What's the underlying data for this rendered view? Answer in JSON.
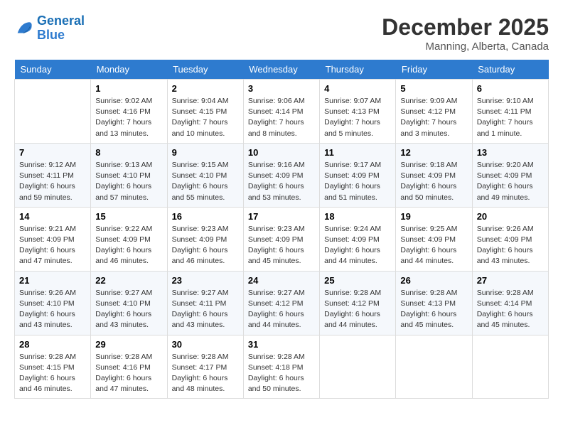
{
  "header": {
    "logo_line1": "General",
    "logo_line2": "Blue",
    "month": "December 2025",
    "location": "Manning, Alberta, Canada"
  },
  "days_of_week": [
    "Sunday",
    "Monday",
    "Tuesday",
    "Wednesday",
    "Thursday",
    "Friday",
    "Saturday"
  ],
  "weeks": [
    [
      {
        "day": "",
        "info": ""
      },
      {
        "day": "1",
        "info": "Sunrise: 9:02 AM\nSunset: 4:16 PM\nDaylight: 7 hours\nand 13 minutes."
      },
      {
        "day": "2",
        "info": "Sunrise: 9:04 AM\nSunset: 4:15 PM\nDaylight: 7 hours\nand 10 minutes."
      },
      {
        "day": "3",
        "info": "Sunrise: 9:06 AM\nSunset: 4:14 PM\nDaylight: 7 hours\nand 8 minutes."
      },
      {
        "day": "4",
        "info": "Sunrise: 9:07 AM\nSunset: 4:13 PM\nDaylight: 7 hours\nand 5 minutes."
      },
      {
        "day": "5",
        "info": "Sunrise: 9:09 AM\nSunset: 4:12 PM\nDaylight: 7 hours\nand 3 minutes."
      },
      {
        "day": "6",
        "info": "Sunrise: 9:10 AM\nSunset: 4:11 PM\nDaylight: 7 hours\nand 1 minute."
      }
    ],
    [
      {
        "day": "7",
        "info": "Sunrise: 9:12 AM\nSunset: 4:11 PM\nDaylight: 6 hours\nand 59 minutes."
      },
      {
        "day": "8",
        "info": "Sunrise: 9:13 AM\nSunset: 4:10 PM\nDaylight: 6 hours\nand 57 minutes."
      },
      {
        "day": "9",
        "info": "Sunrise: 9:15 AM\nSunset: 4:10 PM\nDaylight: 6 hours\nand 55 minutes."
      },
      {
        "day": "10",
        "info": "Sunrise: 9:16 AM\nSunset: 4:09 PM\nDaylight: 6 hours\nand 53 minutes."
      },
      {
        "day": "11",
        "info": "Sunrise: 9:17 AM\nSunset: 4:09 PM\nDaylight: 6 hours\nand 51 minutes."
      },
      {
        "day": "12",
        "info": "Sunrise: 9:18 AM\nSunset: 4:09 PM\nDaylight: 6 hours\nand 50 minutes."
      },
      {
        "day": "13",
        "info": "Sunrise: 9:20 AM\nSunset: 4:09 PM\nDaylight: 6 hours\nand 49 minutes."
      }
    ],
    [
      {
        "day": "14",
        "info": "Sunrise: 9:21 AM\nSunset: 4:09 PM\nDaylight: 6 hours\nand 47 minutes."
      },
      {
        "day": "15",
        "info": "Sunrise: 9:22 AM\nSunset: 4:09 PM\nDaylight: 6 hours\nand 46 minutes."
      },
      {
        "day": "16",
        "info": "Sunrise: 9:23 AM\nSunset: 4:09 PM\nDaylight: 6 hours\nand 46 minutes."
      },
      {
        "day": "17",
        "info": "Sunrise: 9:23 AM\nSunset: 4:09 PM\nDaylight: 6 hours\nand 45 minutes."
      },
      {
        "day": "18",
        "info": "Sunrise: 9:24 AM\nSunset: 4:09 PM\nDaylight: 6 hours\nand 44 minutes."
      },
      {
        "day": "19",
        "info": "Sunrise: 9:25 AM\nSunset: 4:09 PM\nDaylight: 6 hours\nand 44 minutes."
      },
      {
        "day": "20",
        "info": "Sunrise: 9:26 AM\nSunset: 4:09 PM\nDaylight: 6 hours\nand 43 minutes."
      }
    ],
    [
      {
        "day": "21",
        "info": "Sunrise: 9:26 AM\nSunset: 4:10 PM\nDaylight: 6 hours\nand 43 minutes."
      },
      {
        "day": "22",
        "info": "Sunrise: 9:27 AM\nSunset: 4:10 PM\nDaylight: 6 hours\nand 43 minutes."
      },
      {
        "day": "23",
        "info": "Sunrise: 9:27 AM\nSunset: 4:11 PM\nDaylight: 6 hours\nand 43 minutes."
      },
      {
        "day": "24",
        "info": "Sunrise: 9:27 AM\nSunset: 4:12 PM\nDaylight: 6 hours\nand 44 minutes."
      },
      {
        "day": "25",
        "info": "Sunrise: 9:28 AM\nSunset: 4:12 PM\nDaylight: 6 hours\nand 44 minutes."
      },
      {
        "day": "26",
        "info": "Sunrise: 9:28 AM\nSunset: 4:13 PM\nDaylight: 6 hours\nand 45 minutes."
      },
      {
        "day": "27",
        "info": "Sunrise: 9:28 AM\nSunset: 4:14 PM\nDaylight: 6 hours\nand 45 minutes."
      }
    ],
    [
      {
        "day": "28",
        "info": "Sunrise: 9:28 AM\nSunset: 4:15 PM\nDaylight: 6 hours\nand 46 minutes."
      },
      {
        "day": "29",
        "info": "Sunrise: 9:28 AM\nSunset: 4:16 PM\nDaylight: 6 hours\nand 47 minutes."
      },
      {
        "day": "30",
        "info": "Sunrise: 9:28 AM\nSunset: 4:17 PM\nDaylight: 6 hours\nand 48 minutes."
      },
      {
        "day": "31",
        "info": "Sunrise: 9:28 AM\nSunset: 4:18 PM\nDaylight: 6 hours\nand 50 minutes."
      },
      {
        "day": "",
        "info": ""
      },
      {
        "day": "",
        "info": ""
      },
      {
        "day": "",
        "info": ""
      }
    ]
  ]
}
